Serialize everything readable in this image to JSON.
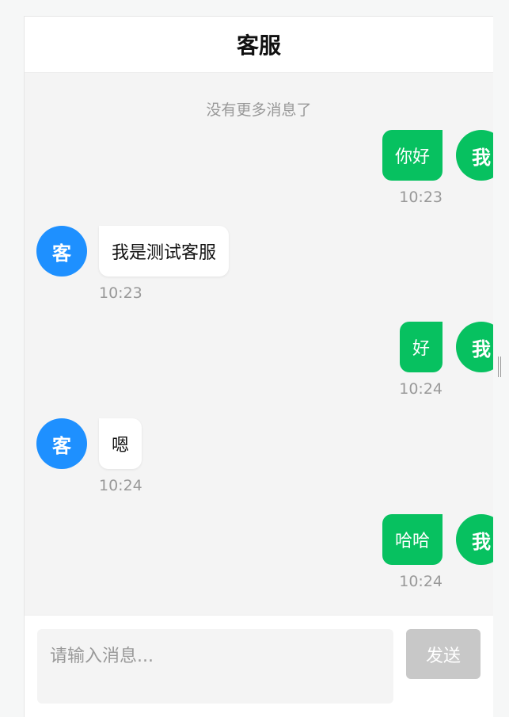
{
  "header": {
    "title": "客服"
  },
  "chat": {
    "no_more_text": "没有更多消息了",
    "messages": [
      {
        "sender": "me",
        "avatar_label": "我",
        "text": "你好",
        "time": "10:23"
      },
      {
        "sender": "kf",
        "avatar_label": "客",
        "text": "我是测试客服",
        "time": "10:23"
      },
      {
        "sender": "me",
        "avatar_label": "我",
        "text": "好",
        "time": "10:24"
      },
      {
        "sender": "kf",
        "avatar_label": "客",
        "text": "嗯",
        "time": "10:24"
      },
      {
        "sender": "me",
        "avatar_label": "我",
        "text": "哈哈",
        "time": "10:24"
      }
    ]
  },
  "input": {
    "placeholder": "请输入消息...",
    "value": "",
    "send_label": "发送"
  },
  "colors": {
    "me_bubble": "#07c160",
    "kf_avatar": "#1e90ff",
    "send_disabled": "#c8c8c8"
  }
}
